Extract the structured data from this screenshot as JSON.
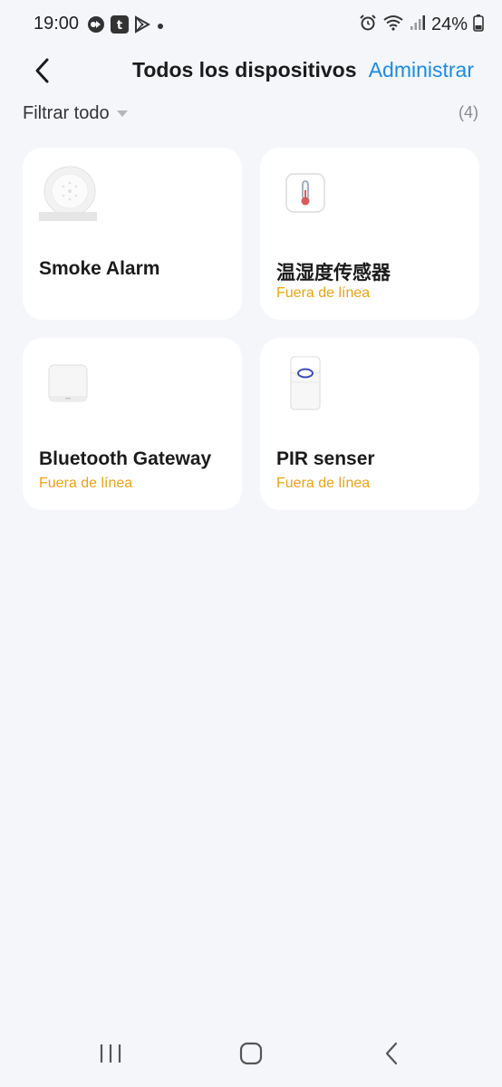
{
  "status_bar": {
    "time": "19:00",
    "battery": "24%",
    "left_icons": [
      "media-icon",
      "tuya-app-icon",
      "play-store-icon",
      "dot-icon"
    ],
    "right_icons": [
      "alarm-icon",
      "wifi-icon",
      "signal-icon",
      "battery-icon"
    ]
  },
  "header": {
    "title": "Todos los dispositivos",
    "manage": "Administrar"
  },
  "filter": {
    "label": "Filtrar todo",
    "count": "(4)"
  },
  "devices": [
    {
      "name": "Smoke Alarm",
      "status": "",
      "icon": "smoke-alarm-icon"
    },
    {
      "name": "温湿度传感器",
      "status": "Fuera de línea",
      "icon": "thermometer-sensor-icon"
    },
    {
      "name": "Bluetooth Gateway",
      "status": "Fuera de línea",
      "icon": "gateway-icon"
    },
    {
      "name": "PIR senser",
      "status": "Fuera de línea",
      "icon": "pir-sensor-icon"
    }
  ],
  "colors": {
    "background": "#f4f6fa",
    "accent": "#1e8be0",
    "offline": "#e8a21a"
  },
  "nav": [
    "recent-apps-icon",
    "home-icon",
    "back-icon"
  ]
}
